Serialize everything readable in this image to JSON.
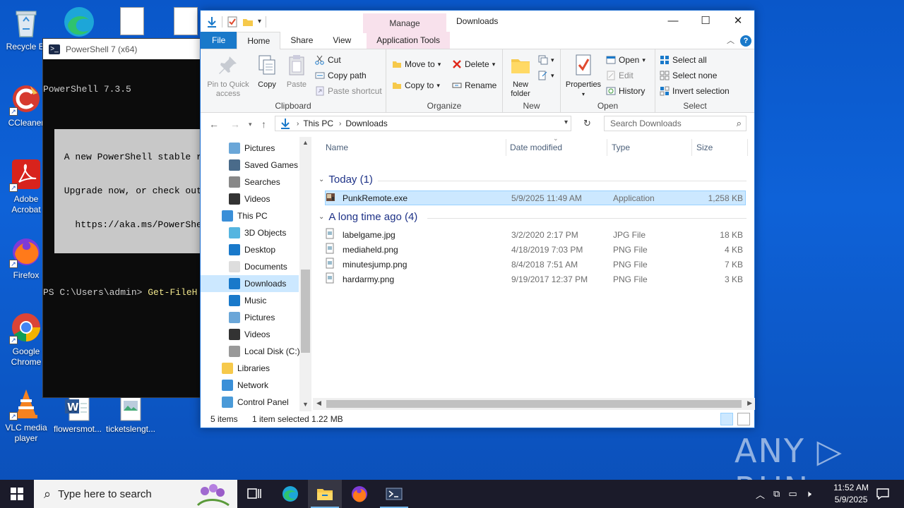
{
  "desktop": {
    "icons": [
      {
        "label": "Recycle Bin",
        "display": "Recycle Bi"
      },
      {
        "label": "CCleaner"
      },
      {
        "label": "Adobe Acrobat",
        "display1": "Adobe",
        "display2": "Acrobat"
      },
      {
        "label": "Firefox"
      },
      {
        "label": "Google Chrome",
        "display1": "Google",
        "display2": "Chrome"
      },
      {
        "label": "VLC media player",
        "display1": "VLC media",
        "display2": "player"
      },
      {
        "label": "flowersmot..."
      },
      {
        "label": "ticketslengt..."
      }
    ],
    "watermark": "ANY ▷ RUN"
  },
  "powershell": {
    "title": "PowerShell 7 (x64)",
    "version_line": "PowerShell 7.3.5",
    "banner": [
      " A new PowerShell stable r",
      " Upgrade now, or check out",
      "   https://aka.ms/PowerShe"
    ],
    "prompt": "PS C:\\Users\\admin> ",
    "command": "Get-FileH"
  },
  "explorer": {
    "caption": "Downloads",
    "manage_label": "Manage",
    "tabs": {
      "file": "File",
      "home": "Home",
      "share": "Share",
      "view": "View",
      "app_tools": "Application Tools"
    },
    "ribbon": {
      "clipboard": {
        "pin": "Pin to Quick access",
        "pin1": "Pin to Quick",
        "pin2": "access",
        "copy": "Copy",
        "paste": "Paste",
        "cut": "Cut",
        "copy_path": "Copy path",
        "paste_shortcut": "Paste shortcut",
        "label": "Clipboard"
      },
      "organize": {
        "move_to": "Move to",
        "copy_to": "Copy to",
        "delete": "Delete",
        "rename": "Rename",
        "label": "Organize"
      },
      "new": {
        "new_folder1": "New",
        "new_folder2": "folder",
        "label": "New"
      },
      "open": {
        "properties": "Properties",
        "open": "Open",
        "edit": "Edit",
        "history": "History",
        "label": "Open"
      },
      "select": {
        "select_all": "Select all",
        "select_none": "Select none",
        "invert": "Invert selection",
        "label": "Select"
      }
    },
    "address": {
      "crumbs": [
        "This PC",
        "Downloads"
      ],
      "search_placeholder": "Search Downloads"
    },
    "nav_items": [
      {
        "label": "Pictures",
        "icon": "pictures-icon"
      },
      {
        "label": "Saved Games",
        "icon": "saved-games-icon"
      },
      {
        "label": "Searches",
        "icon": "searches-icon"
      },
      {
        "label": "Videos",
        "icon": "videos-icon"
      },
      {
        "label": "This PC",
        "icon": "this-pc-icon"
      },
      {
        "label": "3D Objects",
        "icon": "3d-objects-icon"
      },
      {
        "label": "Desktop",
        "icon": "desktop-icon"
      },
      {
        "label": "Documents",
        "icon": "documents-icon"
      },
      {
        "label": "Downloads",
        "icon": "downloads-icon"
      },
      {
        "label": "Music",
        "icon": "music-icon"
      },
      {
        "label": "Pictures",
        "icon": "pictures-icon"
      },
      {
        "label": "Videos",
        "icon": "videos-icon"
      },
      {
        "label": "Local Disk (C:)",
        "icon": "local-disk-icon"
      },
      {
        "label": "Libraries",
        "icon": "libraries-icon"
      },
      {
        "label": "Network",
        "icon": "network-icon"
      },
      {
        "label": "Control Panel",
        "icon": "control-panel-icon"
      }
    ],
    "columns": {
      "name": "Name",
      "date": "Date modified",
      "type": "Type",
      "size": "Size"
    },
    "groups": [
      {
        "title": "Today (1)",
        "files": [
          {
            "name": "PunkRemote.exe",
            "date": "5/9/2025 11:49 AM",
            "type": "Application",
            "size": "1,258 KB",
            "selected": true
          }
        ]
      },
      {
        "title": "A long time ago (4)",
        "files": [
          {
            "name": "labelgame.jpg",
            "date": "3/2/2020 2:17 PM",
            "type": "JPG File",
            "size": "18 KB"
          },
          {
            "name": "mediaheld.png",
            "date": "4/18/2019 7:03 PM",
            "type": "PNG File",
            "size": "4 KB"
          },
          {
            "name": "minutesjump.png",
            "date": "8/4/2018 7:51 AM",
            "type": "PNG File",
            "size": "7 KB"
          },
          {
            "name": "hardarmy.png",
            "date": "9/19/2017 12:37 PM",
            "type": "PNG File",
            "size": "3 KB"
          }
        ]
      }
    ],
    "status": {
      "count": "5 items",
      "selected": "1 item selected",
      "size": "1.22 MB"
    }
  },
  "taskbar": {
    "search_placeholder": "Type here to search",
    "time": "11:52 AM",
    "date": "5/9/2025"
  },
  "colors": {
    "accent": "#1979ca",
    "selection": "#cce8ff",
    "desktop": "#0e62d8"
  }
}
